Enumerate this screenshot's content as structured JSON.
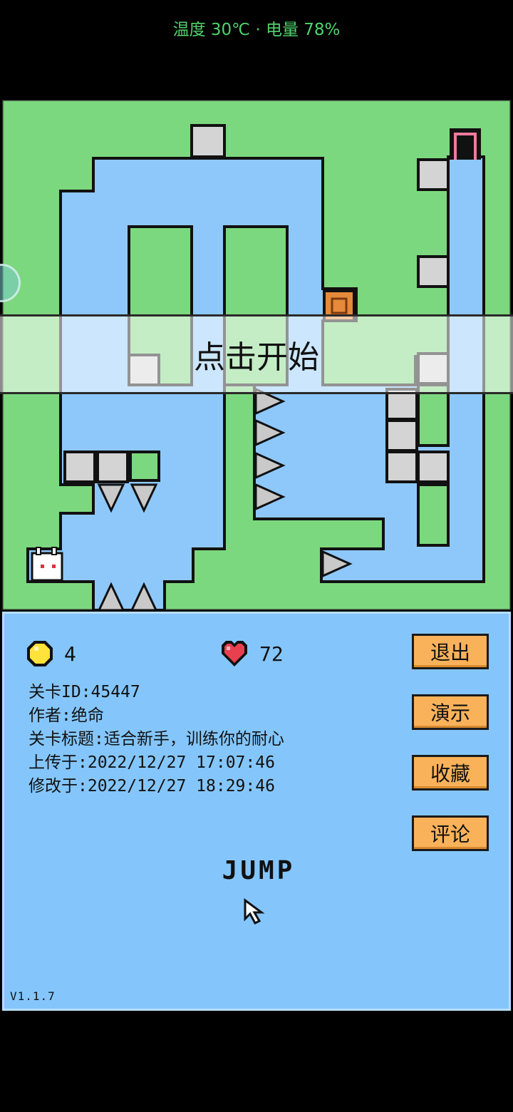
{
  "status_bar": {
    "text": "温度 30℃ · 电量 78%"
  },
  "map": {
    "start_prompt": "点击开始"
  },
  "stats": {
    "coins": "4",
    "lives": "72"
  },
  "level_info": {
    "id": "关卡ID:45447",
    "author": "作者:绝命",
    "title": "关卡标题:适合新手，训练你的耐心",
    "uploaded": "上传于:2022/12/27 17:07:46",
    "modified": "修改于:2022/12/27 18:29:46"
  },
  "buttons": {
    "exit": "退出",
    "demo": "演示",
    "favorite": "收藏",
    "comment": "评论"
  },
  "jump_label": "JUMP",
  "version": "V1.1.7",
  "colors": {
    "grass": "#7cd87e",
    "water": "#8ec8fb",
    "panel": "#84c6fc",
    "button": "#f9b25a",
    "status_text": "#4fd36b"
  }
}
